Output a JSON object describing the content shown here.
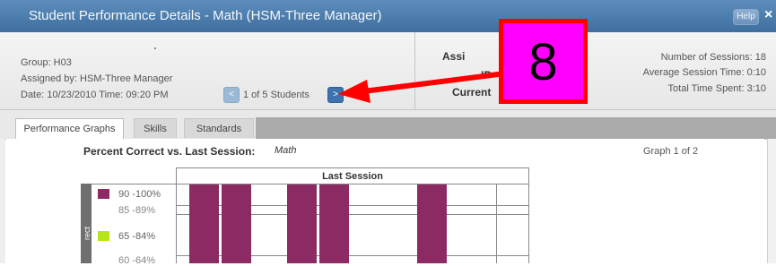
{
  "window": {
    "title": "Student Performance Details  - Math (HSM-Three Manager)",
    "help_label": "Help",
    "close_label": "×"
  },
  "info": {
    "group": "Group: H03",
    "assigned_by": "Assigned by: HSM-Three Manager",
    "date": "Date: 10/23/2010 Time: 09:20 PM",
    "nav_prev": "<",
    "nav_count": "1 of 5 Students",
    "nav_next": ">",
    "mid_label_1": "Assi",
    "mid_label_2": "IP",
    "mid_label_3": "Current"
  },
  "stats": {
    "sessions": "Number of Sessions:  18",
    "avg_time": "Average Session Time:  0:10",
    "total_time": "Total Time Spent:  3:10"
  },
  "callout": {
    "number": "8"
  },
  "tabs": [
    {
      "label": "Performance Graphs",
      "active": true
    },
    {
      "label": "Skills",
      "active": false
    },
    {
      "label": "Standards",
      "active": false
    }
  ],
  "graph": {
    "title": "Percent Correct vs. Last Session:",
    "subject": "Math",
    "count": "Graph 1 of 2",
    "column_header": "Last Session",
    "side_label": "rect",
    "legend": [
      {
        "label": "90 -100%",
        "color": "#8b2a63"
      },
      {
        "label": "85 -89%",
        "color": ""
      },
      {
        "label": "65 -84%",
        "color": "#b6e51a"
      },
      {
        "label": "60 -64%",
        "color": ""
      }
    ],
    "bar_color": "#8b2a63"
  }
}
